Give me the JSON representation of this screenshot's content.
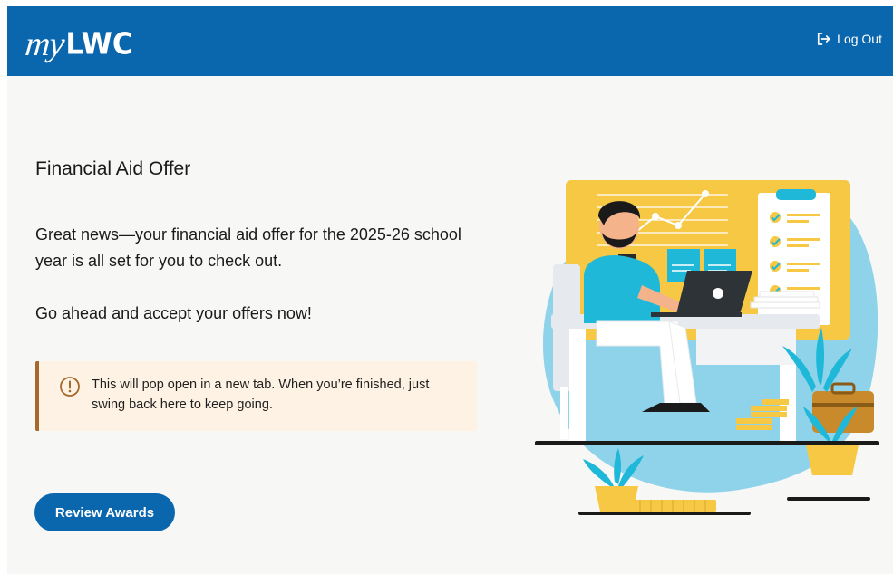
{
  "header": {
    "logo_my": "my",
    "logo_lwc": "LWC",
    "logout_label": "Log Out"
  },
  "main": {
    "title": "Financial Aid Offer",
    "paragraph1": "Great news—your financial aid offer for the 2025-26 school year is all set for you to check out.",
    "paragraph2": "Go ahead and accept your offers now!",
    "notice": "This will pop open in a new tab. When you’re finished, just swing back here to keep going.",
    "review_button": "Review Awards"
  },
  "colors": {
    "brand_blue": "#0a66ad",
    "notice_bg": "#fdf2e3",
    "notice_accent": "#a56a2b",
    "illustration_yellow": "#f7c843",
    "illustration_cyan": "#1fb8d8",
    "illustration_light_blue": "#8fd3ea"
  },
  "icons": {
    "logout": "logout-icon",
    "notice": "warning-circle-icon",
    "illustration": "person-at-laptop-illustration"
  }
}
